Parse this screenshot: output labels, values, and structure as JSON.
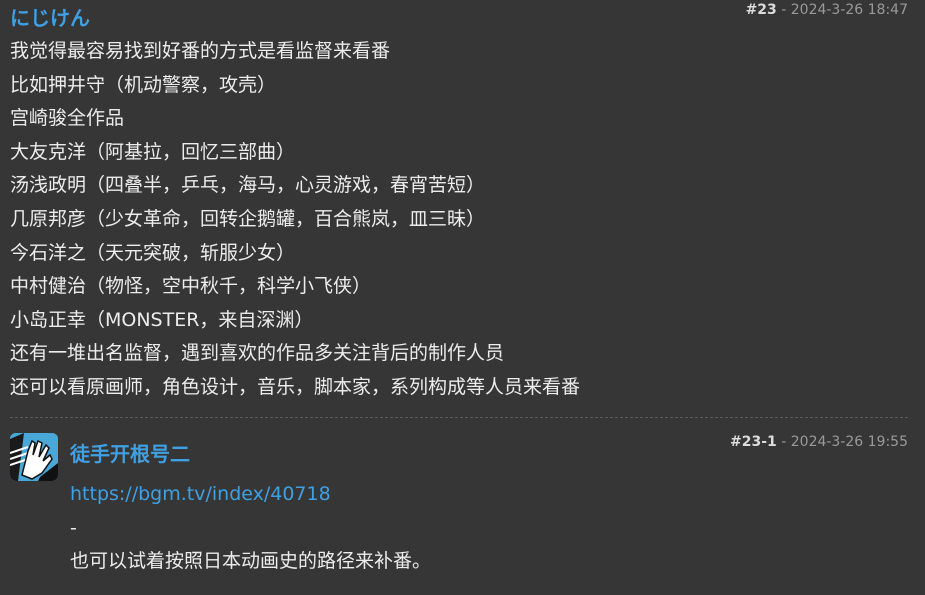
{
  "post": {
    "author": "にじけん",
    "number": "#23",
    "sep": " - ",
    "date": "2024-3-26 18:47",
    "lines": [
      "我觉得最容易找到好番的方式是看监督来看番",
      "比如押井守（机动警察，攻壳）",
      "宫崎骏全作品",
      "大友克洋（阿基拉，回忆三部曲）",
      "汤浅政明（四叠半，乒乓，海马，心灵游戏，春宵苦短）",
      "几原邦彦（少女革命，回转企鹅罐，百合熊岚，皿三昧）",
      "今石洋之（天元突破，斩服少女）",
      "中村健治（物怪，空中秋千，科学小飞侠）",
      "小岛正幸（MONSTER，来自深渊）",
      "还有一堆出名监督，遇到喜欢的作品多关注背后的制作人员",
      "还可以看原画师，角色设计，音乐，脚本家，系列构成等人员来看番"
    ]
  },
  "reply": {
    "author": "徒手开根号二",
    "number": "#23-1",
    "sep": " - ",
    "date": "2024-3-26 19:55",
    "link": "https://bgm.tv/index/40718",
    "dash": "-",
    "text": "也可以试着按照日本动画史的路径来补番。",
    "avatar_icon": "hand-avatar-icon"
  },
  "colors": {
    "background": "#363636",
    "link": "#3fa0e3",
    "meta": "#9a9a9a",
    "text": "#ececec"
  }
}
